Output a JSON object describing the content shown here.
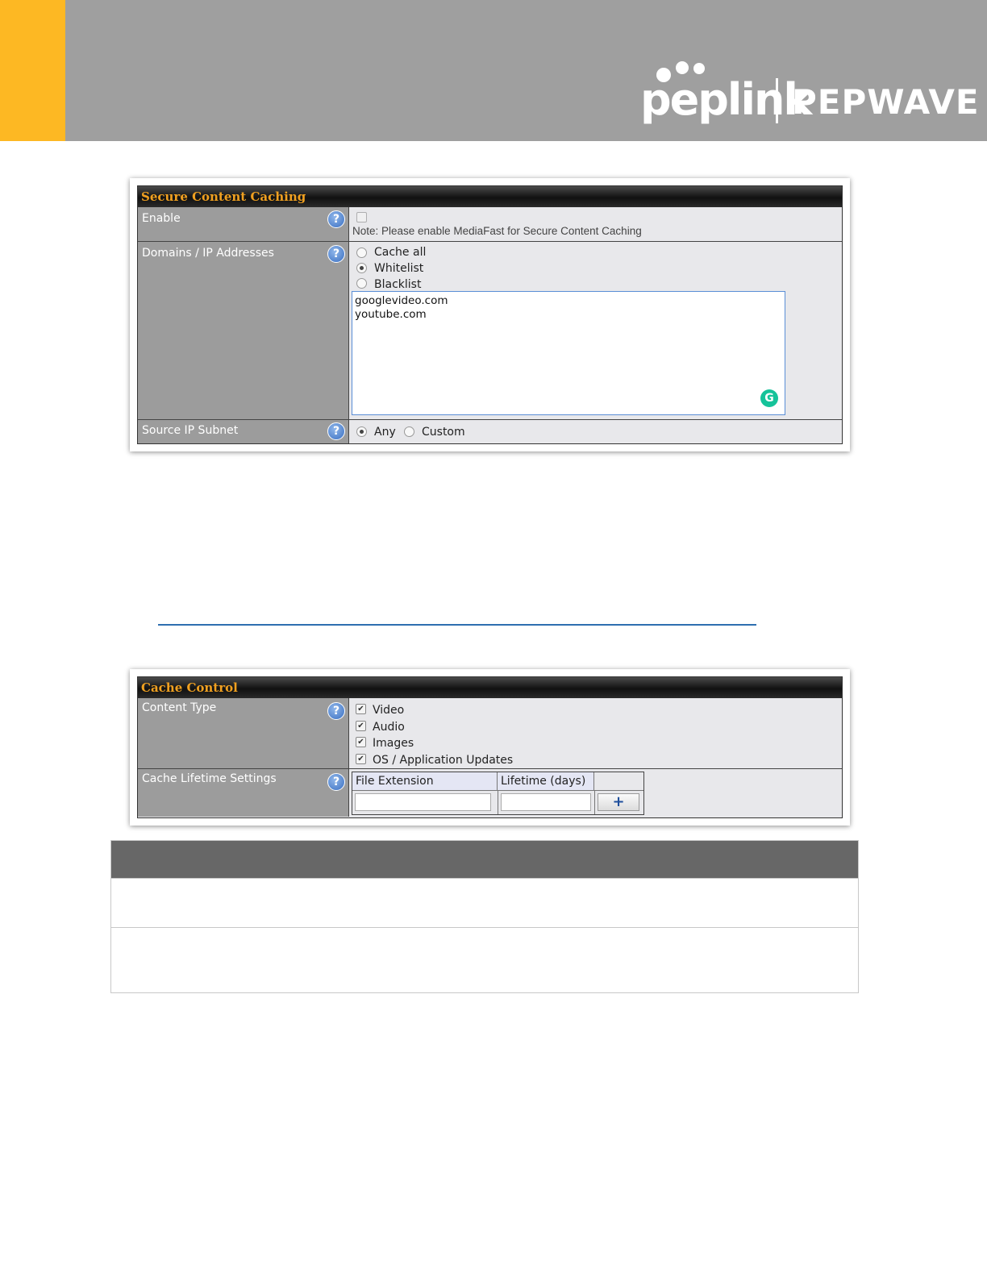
{
  "header": {
    "brand_primary": "peplink",
    "brand_secondary": "PEPWAVE",
    "colors": {
      "banner": "#9f9f9f",
      "accent": "#fdb823"
    }
  },
  "secure_caching": {
    "title": "Secure Content Caching",
    "enable": {
      "label": "Enable",
      "checked": false,
      "note": "Note: Please enable MediaFast for Secure Content Caching"
    },
    "domains": {
      "label": "Domains / IP Addresses",
      "options": [
        "Cache all",
        "Whitelist",
        "Blacklist"
      ],
      "selected": "Whitelist",
      "entries": [
        "googlevideo.com",
        "youtube.com"
      ]
    },
    "source_ip": {
      "label": "Source IP Subnet",
      "options": [
        "Any",
        "Custom"
      ],
      "selected": "Any"
    }
  },
  "cache_control": {
    "title": "Cache Control",
    "content_type": {
      "label": "Content Type",
      "options": [
        "Video",
        "Audio",
        "Images",
        "OS / Application Updates"
      ],
      "checked": [
        true,
        true,
        true,
        true
      ]
    },
    "lifetime": {
      "label": "Cache Lifetime Settings",
      "columns": [
        "File Extension",
        "Lifetime (days)"
      ],
      "add_button": "+"
    }
  }
}
